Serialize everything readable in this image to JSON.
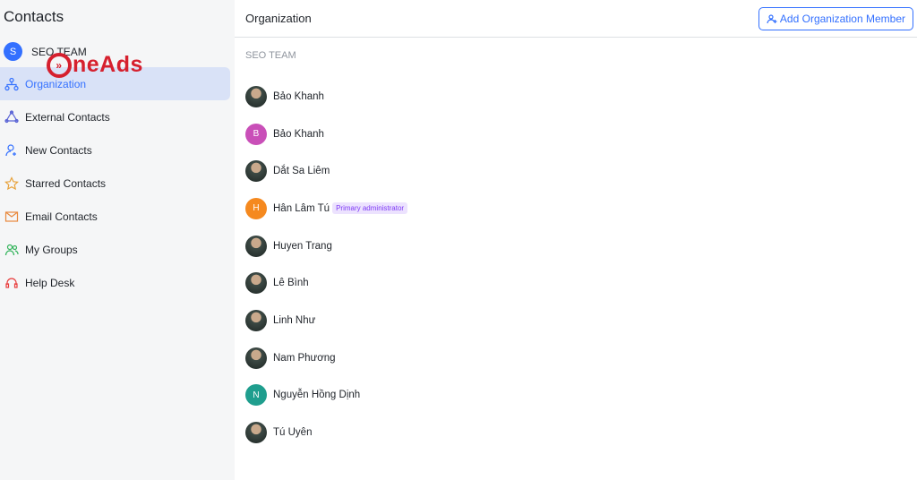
{
  "sidebar": {
    "title": "Contacts",
    "team": {
      "initial": "S",
      "name": "SEO TEAM",
      "color": "#3370ff"
    },
    "items": [
      {
        "label": "Organization",
        "icon": "org-icon",
        "active": true,
        "color": "#3370ff"
      },
      {
        "label": "External Contacts",
        "icon": "external-contacts-icon",
        "color": "#5b65d6"
      },
      {
        "label": "New Contacts",
        "icon": "user-plus-icon",
        "color": "#3370ff"
      },
      {
        "label": "Starred Contacts",
        "icon": "star-icon",
        "color": "#e8a33d"
      },
      {
        "label": "Email Contacts",
        "icon": "email-icon",
        "color": "#e8893d"
      },
      {
        "label": "My Groups",
        "icon": "group-icon",
        "color": "#34b45c"
      },
      {
        "label": "Help Desk",
        "icon": "headset-icon",
        "color": "#e83d3d"
      }
    ]
  },
  "watermark": "OneAds",
  "header": {
    "title": "Organization",
    "add_button": "Add Organization Member"
  },
  "section": "SEO TEAM",
  "members": [
    {
      "name": "Bảo Khanh",
      "photo": true
    },
    {
      "name": "Bảo Khanh",
      "initial": "B",
      "color": "#c94fb8"
    },
    {
      "name": "Dắt Sa Liêm",
      "photo": true
    },
    {
      "name": "Hân Lâm Tú",
      "initial": "H",
      "color": "#f5891f",
      "badge": "Primary administrator"
    },
    {
      "name": "Huyen Trang",
      "photo": true
    },
    {
      "name": "Lê Bình",
      "photo": true
    },
    {
      "name": "Linh Như",
      "photo": true
    },
    {
      "name": "Nam Phương",
      "photo": true
    },
    {
      "name": "Nguyễn Hồng Dịnh",
      "initial": "N",
      "color": "#1f9e8e"
    },
    {
      "name": "Tú Uyên",
      "photo": true
    }
  ]
}
